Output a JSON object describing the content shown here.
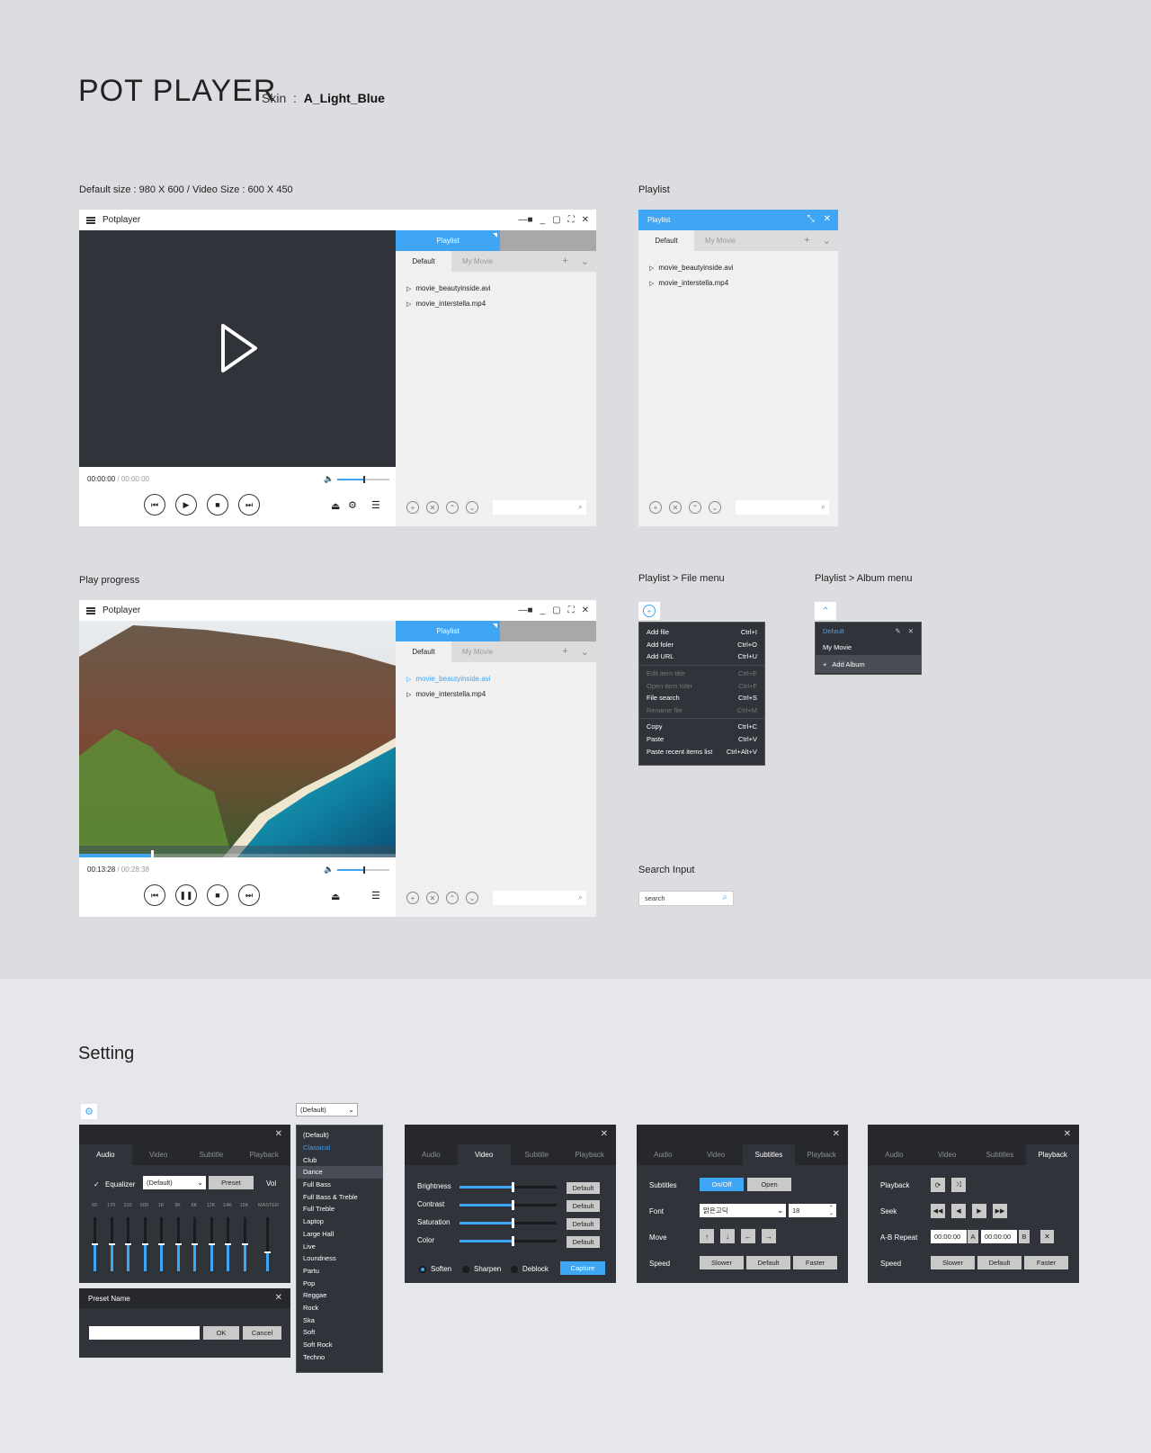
{
  "header": {
    "title": "POT PLAYER",
    "skin_label": "Skin",
    "skin_sep": ":",
    "skin_name": "A_Light_Blue"
  },
  "captions": {
    "default_size": "Default size : 980 X 600  /  Video Size : 600 X 450",
    "playlist": "Playlist",
    "play_progress": "Play progress",
    "file_menu": "Playlist > File menu",
    "album_menu": "Playlist > Album menu",
    "search_input": "Search Input",
    "setting": "Setting"
  },
  "player": {
    "title": "Potplayer",
    "time_idle": "00:00:00",
    "dur_idle": "/ 00:00:00",
    "time_play": "00:13:28",
    "dur_play": "/ 00:28:38",
    "progress_fraction": 0.23,
    "volume_fraction": 0.5
  },
  "playlist": {
    "tab_label": "Playlist",
    "tab_default": "Default",
    "tab_my_movie": "My Movie",
    "items": [
      "movie_beautyinside.avi",
      "movie_interstella.mp4"
    ],
    "playing_index": 0
  },
  "file_menu": {
    "groups": [
      [
        {
          "label": "Add file",
          "key": "Ctrl+I"
        },
        {
          "label": "Add foler",
          "key": "Ctrl+O"
        },
        {
          "label": "Add URL",
          "key": "Ctrl+U"
        }
      ],
      [
        {
          "label": "Edit item title",
          "key": "Ctrl+E",
          "dim": true
        },
        {
          "label": "Open item foler",
          "key": "Ctrl+F",
          "dim": true
        },
        {
          "label": "File search",
          "key": "Ctrl+S"
        },
        {
          "label": "Rename file",
          "key": "Ctrl+M",
          "dim": true
        }
      ],
      [
        {
          "label": "Copy",
          "key": "Ctrl+C"
        },
        {
          "label": "Paste",
          "key": "Ctrl+V"
        },
        {
          "label": "Paste recent items list",
          "key": "Ctrl+Alt+V"
        }
      ]
    ]
  },
  "album_menu": {
    "items": [
      "Default",
      "My Movie"
    ],
    "add": "Add Album"
  },
  "search": {
    "placeholder": "search"
  },
  "settings": {
    "tabs": [
      "Audio",
      "Video",
      "Subtitle",
      "Playback"
    ],
    "tabs_sub": [
      "Audio",
      "Video",
      "Subtitles",
      "Playback"
    ],
    "audio": {
      "equalizer": "Equalizer",
      "preset_value": "(Default)",
      "preset_btn": "Preset",
      "vol": "Vol",
      "bands": [
        "60",
        "170",
        "310",
        "600",
        "1K",
        "3K",
        "6K",
        "12K",
        "14K",
        "16K",
        "MASTER"
      ],
      "levels": [
        0.5,
        0.5,
        0.5,
        0.5,
        0.5,
        0.5,
        0.5,
        0.5,
        0.5,
        0.5,
        0.35
      ]
    },
    "preset_dialog": {
      "title": "Preset Name",
      "ok": "OK",
      "cancel": "Cancel"
    },
    "preset_select": "(Default)",
    "preset_list": [
      "(Default)",
      "Classical",
      "Club",
      "Dance",
      "Full Bass",
      "Full Bass & Treble",
      "Full Treble",
      "Laptop",
      "Large Hall",
      "Live",
      "Loundness",
      "Partu",
      "Pop",
      "Reggae",
      "Rock",
      "Ska",
      "Soft",
      "Soft Rock",
      "Techno"
    ],
    "preset_selected": 1,
    "preset_hover": 3,
    "video": {
      "rows": [
        "Brightness",
        "Contrast",
        "Saturation",
        "Color"
      ],
      "values": [
        0.55,
        0.55,
        0.55,
        0.55
      ],
      "default_btn": "Default",
      "filters": [
        "Soften",
        "Sharpen",
        "Deblock"
      ],
      "capture": "Capture"
    },
    "subtitle": {
      "subtitles": "Subtitles",
      "onoff": "On/Off",
      "open": "Open",
      "font": "Font",
      "font_value": "맑은고딕",
      "size_value": "18",
      "move": "Move",
      "speed": "Speed",
      "slower": "Slower",
      "default": "Default",
      "faster": "Faster"
    },
    "playback": {
      "playback": "Playback",
      "seek": "Seek",
      "ab": "A-B Repeat",
      "a_time": "00:00:00",
      "b_time": "00:00:00",
      "a": "A",
      "b": "B",
      "speed": "Speed",
      "slower": "Slower",
      "default": "Default",
      "faster": "Faster"
    }
  },
  "colors": {
    "accent": "#3fa6f5",
    "dark": "#30333a",
    "bg": "#dcdde0"
  }
}
